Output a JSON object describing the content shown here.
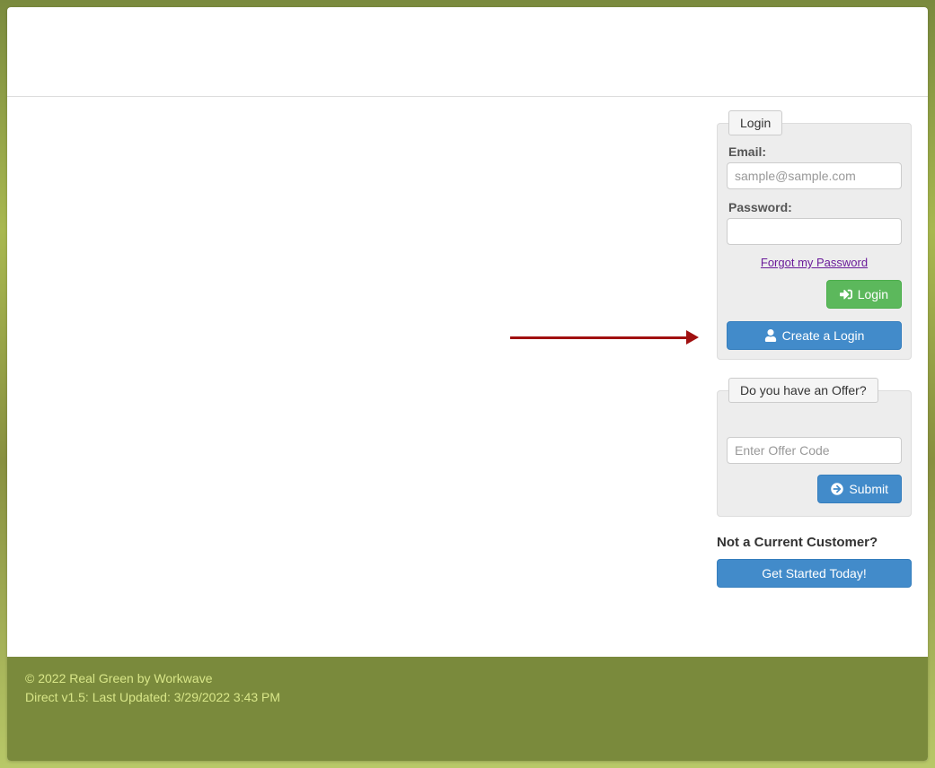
{
  "login_panel": {
    "legend": "Login",
    "email_label": "Email:",
    "email_placeholder": "sample@sample.com",
    "password_label": "Password:",
    "forgot_link": "Forgot my Password",
    "login_button": "Login",
    "create_button": "Create a Login"
  },
  "offer_panel": {
    "legend": "Do you have an Offer?",
    "offer_placeholder": "Enter Offer Code",
    "submit_button": "Submit"
  },
  "not_customer": {
    "heading": "Not a Current Customer?",
    "cta_button": "Get Started Today!"
  },
  "footer": {
    "copyright": "© 2022 Real Green by Workwave",
    "version": "Direct v1.5: Last Updated: 3/29/2022 3:43 PM"
  }
}
